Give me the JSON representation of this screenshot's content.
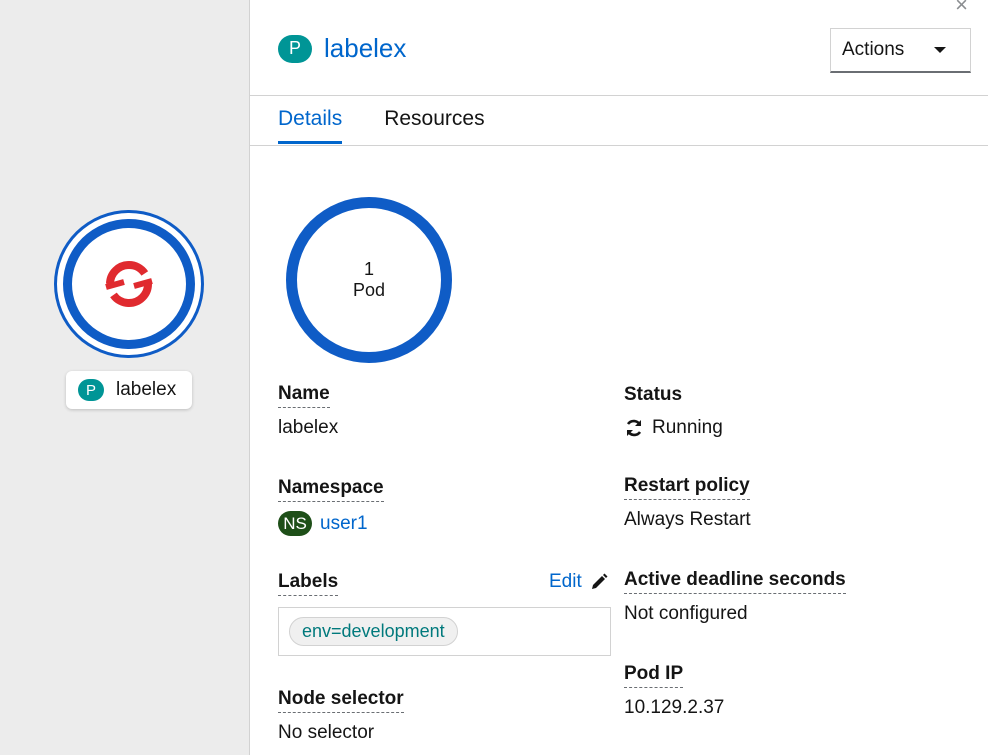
{
  "topology": {
    "node_label": "labelex",
    "node_badge": "P",
    "node_icon": "openshift-logo-icon"
  },
  "panel": {
    "close_glyph": "×",
    "title_badge": "P",
    "title": "labelex",
    "actions_label": "Actions",
    "tabs": [
      {
        "label": "Details",
        "active": true
      },
      {
        "label": "Resources",
        "active": false
      }
    ],
    "donut": {
      "count": "1",
      "unit": "Pod"
    },
    "details": {
      "name_label": "Name",
      "name_value": "labelex",
      "namespace_label": "Namespace",
      "namespace_badge": "NS",
      "namespace_value": "user1",
      "labels_label": "Labels",
      "edit_label": "Edit",
      "labels": [
        "env=development"
      ],
      "node_selector_label": "Node selector",
      "node_selector_value": "No selector",
      "status_label": "Status",
      "status_value": "Running",
      "restart_policy_label": "Restart policy",
      "restart_policy_value": "Always Restart",
      "active_deadline_label": "Active deadline seconds",
      "active_deadline_value": "Not configured",
      "pod_ip_label": "Pod IP",
      "pod_ip_value": "10.129.2.37"
    }
  },
  "colors": {
    "accent": "#0066cc",
    "ring": "#0f5cc6",
    "pod_badge": "#009596",
    "ns_badge": "#1e4f18",
    "logo_red": "#e02a2f"
  }
}
